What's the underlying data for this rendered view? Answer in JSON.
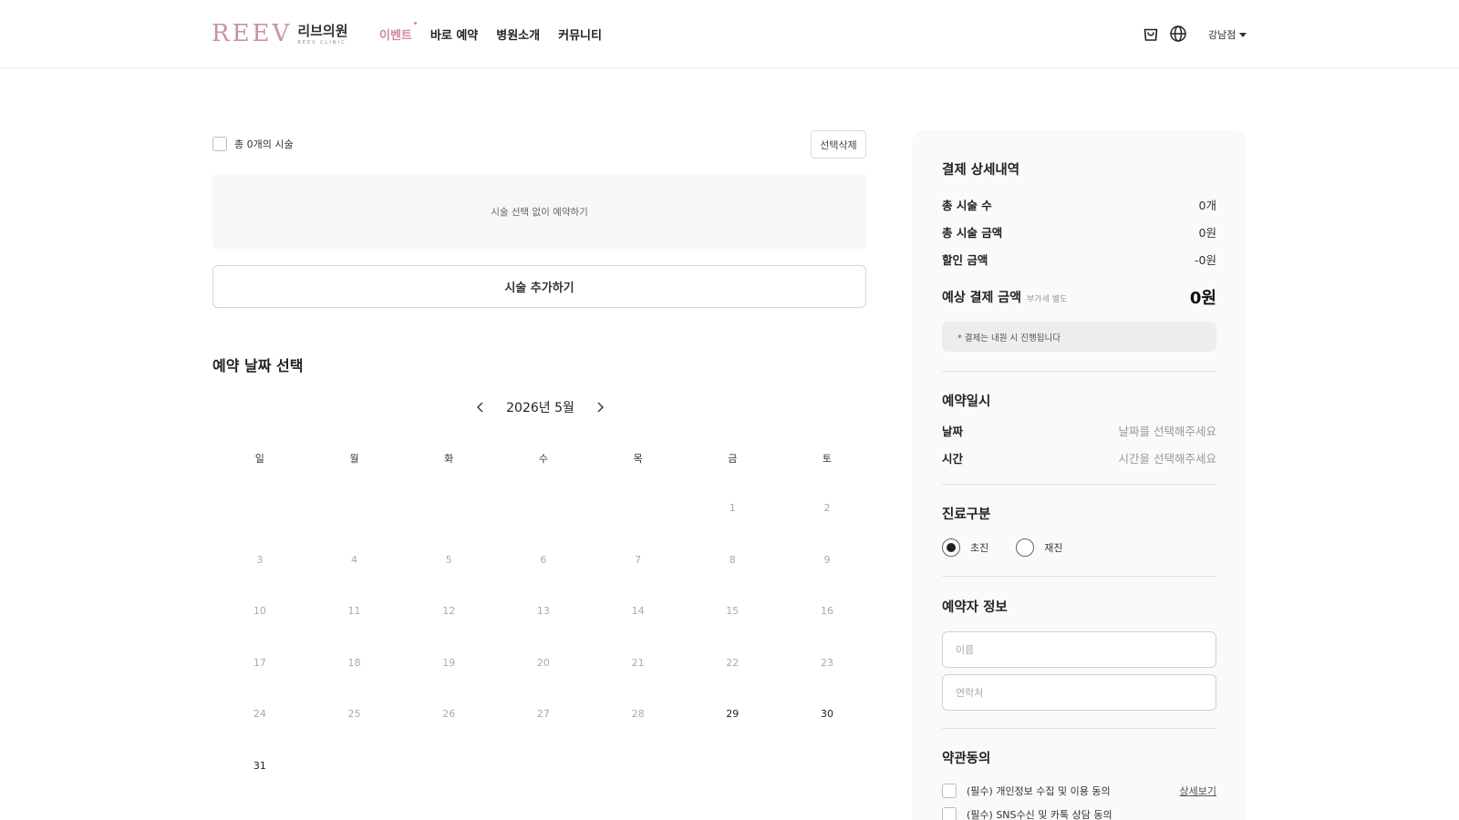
{
  "header": {
    "logo_mark": "REEV",
    "logo_ko": "리브의원",
    "logo_en": "REEV CLINIC",
    "nav": [
      "이벤트",
      "바로 예약",
      "병원소개",
      "커뮤니티"
    ],
    "branch": "강남점",
    "accent_color": "#d08a97",
    "icons": [
      "shopping-bag-icon",
      "globe-icon",
      "caret-down-icon"
    ]
  },
  "treatments": {
    "select_all_label": "총 0개의 시술",
    "delete_label": "선택삭제",
    "empty_label": "시술 선택 없이 예약하기",
    "add_label": "시술 추가하기"
  },
  "calendar": {
    "title": "예약 날짜 선택",
    "month_label": "2026년 5월",
    "weekdays": [
      "일",
      "월",
      "화",
      "수",
      "목",
      "금",
      "토"
    ],
    "weeks": [
      [
        "",
        "",
        "",
        "",
        "",
        "1",
        "2"
      ],
      [
        "3",
        "4",
        "5",
        "6",
        "7",
        "8",
        "9"
      ],
      [
        "10",
        "11",
        "12",
        "13",
        "14",
        "15",
        "16"
      ],
      [
        "17",
        "18",
        "19",
        "20",
        "21",
        "22",
        "23"
      ],
      [
        "24",
        "25",
        "26",
        "27",
        "28",
        "29",
        "30"
      ],
      [
        "31",
        "",
        "",
        "",
        "",
        "",
        ""
      ]
    ],
    "available_days": [
      "29",
      "30",
      "31"
    ]
  },
  "payment": {
    "title": "결제 상세내역",
    "total_count_label": "총 시술 수",
    "total_count_value": "0개",
    "total_amount_label": "총 시술 금액",
    "total_amount_value": "0원",
    "discount_label": "할인 금액",
    "discount_value": "-0원",
    "expected_label": "예상 결제 금액",
    "vat_label": "부가세 별도",
    "expected_value": "0원",
    "note": "* 결제는 내원 시 진행됩니다"
  },
  "reservation": {
    "title": "예약일시",
    "date_label": "날짜",
    "date_placeholder": "날짜를 선택해주세요",
    "time_label": "시간",
    "time_placeholder": "시간을 선택해주세요"
  },
  "visit_type": {
    "title": "진료구분",
    "options": [
      "초진",
      "재진"
    ],
    "selected": "초진"
  },
  "booker": {
    "title": "예약자 정보",
    "name_placeholder": "이름",
    "phone_placeholder": "연락처"
  },
  "terms": {
    "title": "약관동의",
    "items": [
      {
        "label": "(필수) 개인정보 수집 및 이용 동의",
        "link": "상세보기"
      },
      {
        "label": "(필수) SNS수신 및 카톡 상담 동의",
        "link": ""
      }
    ]
  }
}
